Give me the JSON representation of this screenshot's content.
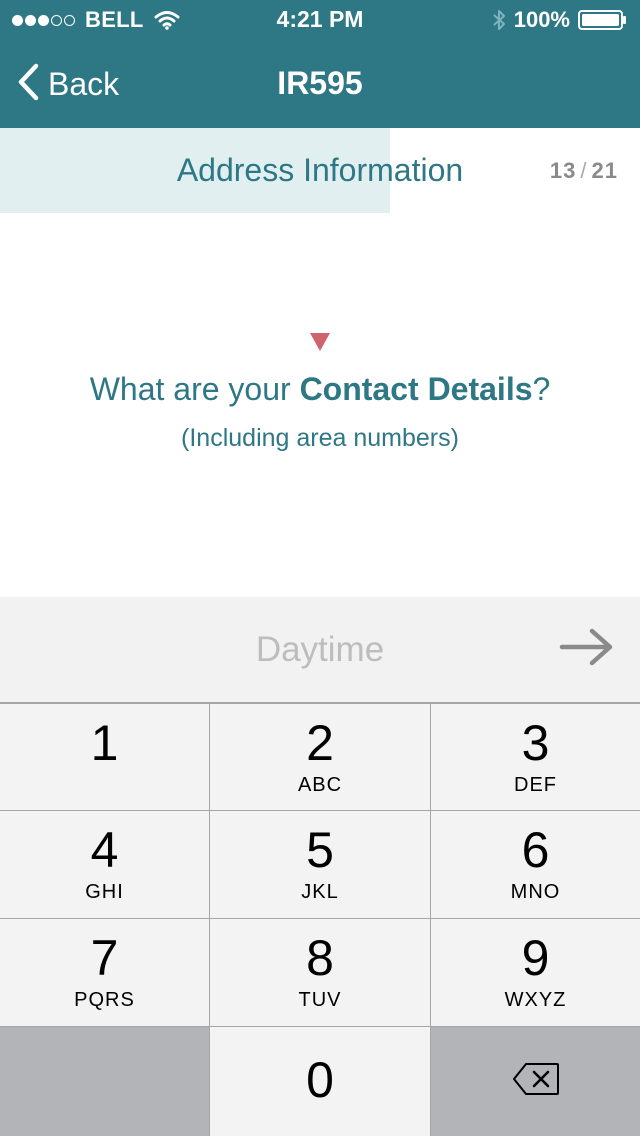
{
  "status_bar": {
    "carrier": "BELL",
    "signal_bars_filled": 3,
    "signal_bars_total": 5,
    "time": "4:21 PM",
    "battery": "100%",
    "battery_level": 1.0
  },
  "nav": {
    "back_label": "Back",
    "title": "IR595"
  },
  "progress": {
    "section_title": "Address Information",
    "current_step": "13",
    "total_steps": "21",
    "fill_fraction": 0.61
  },
  "question": {
    "prefix": "What are your ",
    "emphasis": "Contact Details",
    "suffix": "?",
    "subtitle": "(Including area numbers)"
  },
  "input": {
    "placeholder": "Daytime",
    "value": ""
  },
  "keypad": {
    "keys": [
      {
        "num": "1",
        "letters": ""
      },
      {
        "num": "2",
        "letters": "ABC"
      },
      {
        "num": "3",
        "letters": "DEF"
      },
      {
        "num": "4",
        "letters": "GHI"
      },
      {
        "num": "5",
        "letters": "JKL"
      },
      {
        "num": "6",
        "letters": "MNO"
      },
      {
        "num": "7",
        "letters": "PQRS"
      },
      {
        "num": "8",
        "letters": "TUV"
      },
      {
        "num": "9",
        "letters": "WXYZ"
      },
      {
        "num": "0",
        "letters": ""
      }
    ]
  },
  "colors": {
    "header": "#2e7785",
    "progress_fill": "#e1eff0",
    "marker": "#d0636e",
    "accent_text": "#2e7785"
  },
  "icons": {
    "back": "chevron-left-icon",
    "wifi": "wifi-icon",
    "bluetooth": "bluetooth-icon",
    "battery": "battery-icon",
    "next": "arrow-right-icon",
    "delete": "backspace-icon",
    "marker": "triangle-down-icon"
  }
}
